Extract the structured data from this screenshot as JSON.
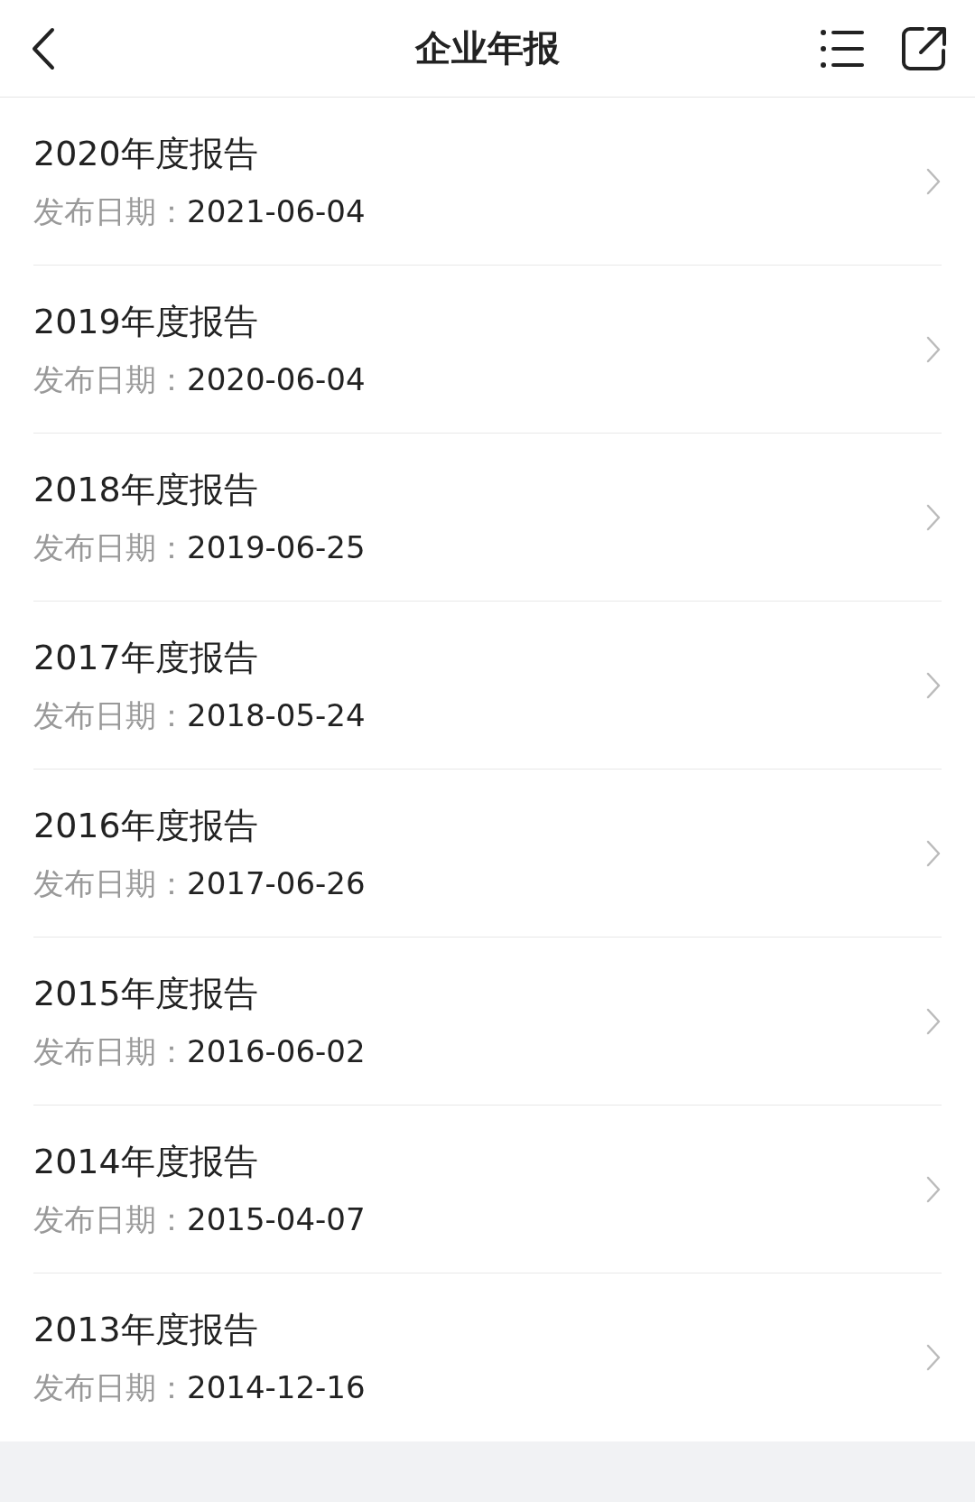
{
  "header": {
    "title": "企业年报"
  },
  "reports": [
    {
      "title": "2020年度报告",
      "date_label": "发布日期：",
      "date": "2021-06-04"
    },
    {
      "title": "2019年度报告",
      "date_label": "发布日期：",
      "date": "2020-06-04"
    },
    {
      "title": "2018年度报告",
      "date_label": "发布日期：",
      "date": "2019-06-25"
    },
    {
      "title": "2017年度报告",
      "date_label": "发布日期：",
      "date": "2018-05-24"
    },
    {
      "title": "2016年度报告",
      "date_label": "发布日期：",
      "date": "2017-06-26"
    },
    {
      "title": "2015年度报告",
      "date_label": "发布日期：",
      "date": "2016-06-02"
    },
    {
      "title": "2014年度报告",
      "date_label": "发布日期：",
      "date": "2015-04-07"
    },
    {
      "title": "2013年度报告",
      "date_label": "发布日期：",
      "date": "2014-12-16"
    }
  ]
}
